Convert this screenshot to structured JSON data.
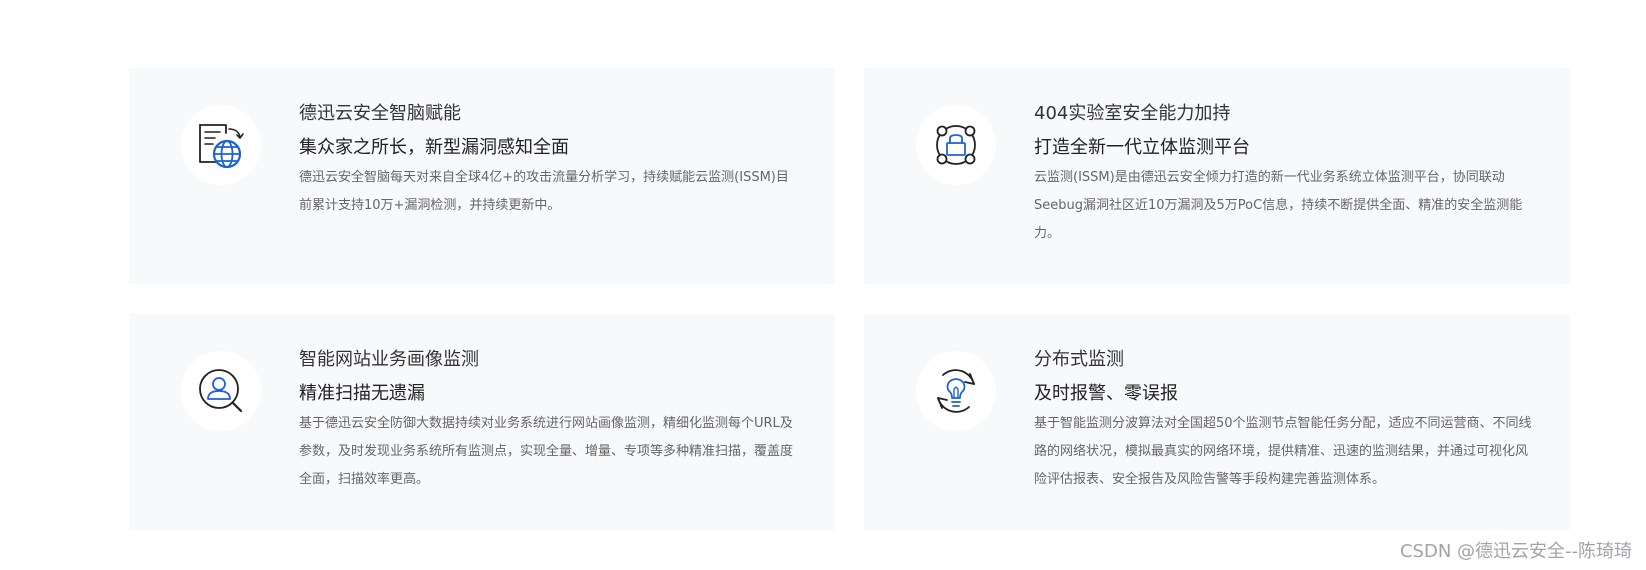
{
  "accent_color": "#1c62d4",
  "cards": [
    {
      "icon": "globe-document-icon",
      "title": "德迅云安全智脑赋能",
      "subtitle": "集众家之所长，新型漏洞感知全面",
      "description": "德迅云安全智脑每天对来自全球4亿+的攻击流量分析学习，持续赋能云监测(ISSM)目前累计支持10万+漏洞检测，并持续更新中。"
    },
    {
      "icon": "lock-network-icon",
      "title": "404实验室安全能力加持",
      "subtitle": "打造全新一代立体监测平台",
      "description": "云监测(ISSM)是由德迅云安全倾力打造的新一代业务系统立体监测平台，协同联动Seebug漏洞社区近10万漏洞及5万PoC信息，持续不断提供全面、精准的安全监测能力。"
    },
    {
      "icon": "user-search-icon",
      "title": "智能网站业务画像监测",
      "subtitle": "精准扫描无遗漏",
      "description": "基于德迅云安全防御大数据持续对业务系统进行网站画像监测，精细化监测每个URL及参数，及时发现业务系统所有监测点，实现全量、增量、专项等多种精准扫描，覆盖度全面，扫描效率更高。"
    },
    {
      "icon": "lightbulb-cycle-icon",
      "title": "分布式监测",
      "subtitle": "及时报警、零误报",
      "description": "基于智能监测分波算法对全国超50个监测节点智能任务分配，适应不同运营商、不同线路的网络状况，模拟最真实的网络环境，提供精准、迅速的监测结果，并通过可视化风险评估报表、安全报告及风险告警等手段构建完善监测体系。"
    }
  ],
  "watermark": "CSDN @德迅云安全--陈琦琦"
}
